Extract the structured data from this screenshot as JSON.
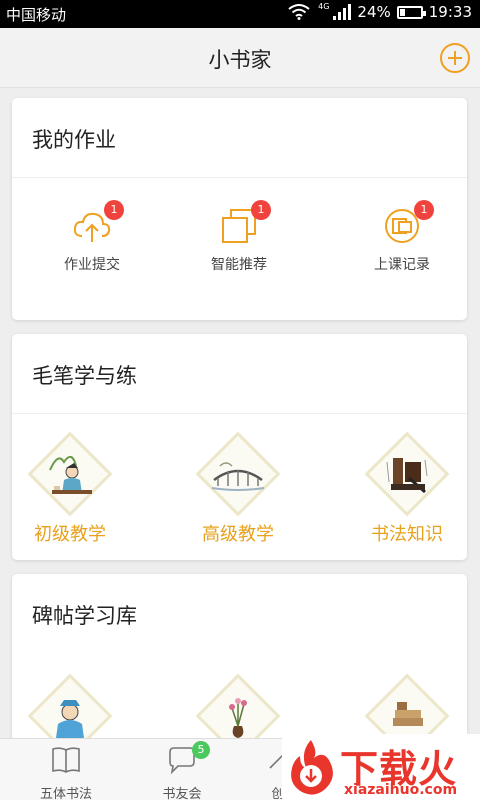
{
  "status_bar": {
    "carrier": "中国移动",
    "network": "4G",
    "battery": "24%",
    "battery_level": 0.24,
    "time": "19:33"
  },
  "header": {
    "title": "小书家",
    "add_icon": "plus-circle-icon",
    "accent": "#f0a020"
  },
  "homework": {
    "title": "我的作业",
    "items": [
      {
        "label": "作业提交",
        "icon": "cloud-upload-icon",
        "badge": "1"
      },
      {
        "label": "智能推荐",
        "icon": "stacked-squares-icon",
        "badge": "1"
      },
      {
        "label": "上课记录",
        "icon": "record-circle-icon",
        "badge": "1"
      }
    ]
  },
  "brush": {
    "title": "毛笔学与练",
    "items": [
      {
        "label": "初级教学",
        "icon": "scholar-writing-illustration"
      },
      {
        "label": "高级教学",
        "icon": "bridge-landscape-illustration"
      },
      {
        "label": "书法知识",
        "icon": "ink-stone-illustration"
      }
    ]
  },
  "library": {
    "title": "碑帖学习库",
    "items": [
      {
        "icon": "child-scholar-illustration"
      },
      {
        "icon": "flower-vase-illustration"
      },
      {
        "icon": "books-illustration"
      }
    ]
  },
  "tabbar": {
    "items": [
      {
        "label": "五体书法",
        "icon": "book-icon"
      },
      {
        "label": "书友会",
        "icon": "chat-bubble-icon",
        "badge": "5"
      },
      {
        "label": "创",
        "icon": "create-icon"
      }
    ]
  },
  "watermark": {
    "title": "下载火",
    "url": "xiazaihuo.com"
  },
  "colors": {
    "badge": "#f0433d",
    "tab_badge": "#4cc95e",
    "art_label": "#e8a11c",
    "watermark": "#e8362d"
  }
}
